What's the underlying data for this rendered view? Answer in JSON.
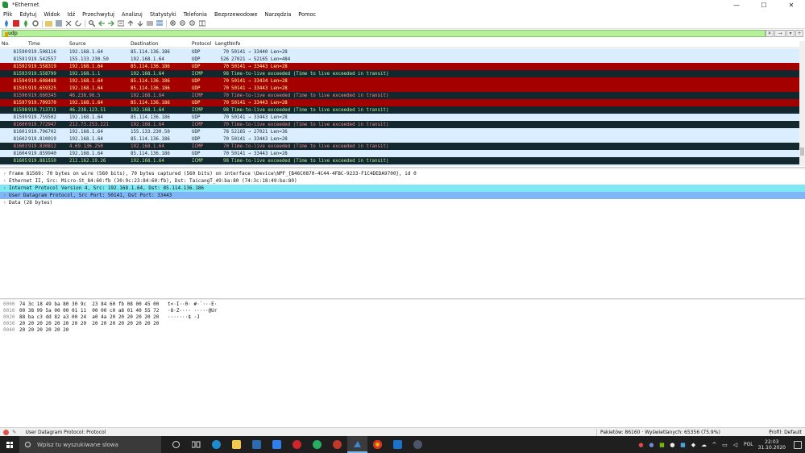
{
  "window": {
    "title": "*Ethernet",
    "min": "—",
    "max": "☐",
    "close": "✕"
  },
  "menu": [
    "Plik",
    "Edytuj",
    "Widok",
    "Idź",
    "Przechwytuj",
    "Analizuj",
    "Statystyki",
    "Telefonia",
    "Bezprzewodowe",
    "Narzędzia",
    "Pomoc"
  ],
  "filter": {
    "value": "udp"
  },
  "columns": {
    "no": "No.",
    "time": "Time",
    "source": "Source",
    "destination": "Destination",
    "protocol": "Protocol",
    "length": "Length",
    "info": "Info"
  },
  "packets": [
    {
      "no": "81590",
      "time": "919.508116",
      "src": "192.168.1.64",
      "dst": "85.114.136.186",
      "proto": "UDP",
      "len": "70",
      "info": "50141 → 33440 Len=28",
      "style": "udp"
    },
    {
      "no": "81591",
      "time": "919.542557",
      "src": "155.133.230.50",
      "dst": "192.168.1.64",
      "proto": "UDP",
      "len": "526",
      "info": "27021 → 52165 Len=484",
      "style": "udp"
    },
    {
      "no": "81592",
      "time": "919.558319",
      "src": "192.168.1.64",
      "dst": "85.114.136.186",
      "proto": "UDP",
      "len": "70",
      "info": "50141 → 33443 Len=28",
      "style": "udp-mark"
    },
    {
      "no": "81593",
      "time": "919.558799",
      "src": "192.168.1.1",
      "dst": "192.168.1.64",
      "proto": "ICMP",
      "len": "98",
      "info": "Time-to-live exceeded (Time to live exceeded in transit)",
      "style": "icmp-alt"
    },
    {
      "no": "81594",
      "time": "919.608488",
      "src": "192.168.1.64",
      "dst": "85.114.136.186",
      "proto": "UDP",
      "len": "70",
      "info": "50141 → 33434 Len=28",
      "style": "udp-mark"
    },
    {
      "no": "81595",
      "time": "919.659325",
      "src": "192.168.1.64",
      "dst": "85.114.136.186",
      "proto": "UDP",
      "len": "70",
      "info": "50141 → 33443 Len=28",
      "style": "udp-mark"
    },
    {
      "no": "81596",
      "time": "919.660345",
      "src": "46.238.96.5",
      "dst": "192.168.1.64",
      "proto": "ICMP",
      "len": "70",
      "info": "Time-to-live exceeded (Time to live exceeded in transit)",
      "style": "icmp"
    },
    {
      "no": "81597",
      "time": "919.709370",
      "src": "192.168.1.64",
      "dst": "85.114.136.186",
      "proto": "UDP",
      "len": "70",
      "info": "50141 → 33443 Len=28",
      "style": "udp-mark"
    },
    {
      "no": "81598",
      "time": "919.713731",
      "src": "46.238.123.51",
      "dst": "192.168.1.64",
      "proto": "ICMP",
      "len": "98",
      "info": "Time-to-live exceeded (Time to live exceeded in transit)",
      "style": "icmp-alt"
    },
    {
      "no": "81599",
      "time": "919.759502",
      "src": "192.168.1.64",
      "dst": "85.114.136.186",
      "proto": "UDP",
      "len": "70",
      "info": "50141 → 33443 Len=28",
      "style": "udp"
    },
    {
      "no": "81600",
      "time": "919.772947",
      "src": "212.73.253.221",
      "dst": "192.168.1.64",
      "proto": "ICMP",
      "len": "70",
      "info": "Time-to-live exceeded (Time to live exceeded in transit)",
      "style": "icmp"
    },
    {
      "no": "81601",
      "time": "919.796702",
      "src": "192.168.1.64",
      "dst": "155.133.230.50",
      "proto": "UDP",
      "len": "78",
      "info": "52165 → 27021 Len=36",
      "style": "udp"
    },
    {
      "no": "81602",
      "time": "919.810019",
      "src": "192.168.1.64",
      "dst": "85.114.136.186",
      "proto": "UDP",
      "len": "70",
      "info": "50141 → 33443 Len=28",
      "style": "udp"
    },
    {
      "no": "81603",
      "time": "919.830812",
      "src": "4.69.136.250",
      "dst": "192.168.1.64",
      "proto": "ICMP",
      "len": "70",
      "info": "Time-to-live exceeded (Time to live exceeded in transit)",
      "style": "icmp"
    },
    {
      "no": "81604",
      "time": "919.859940",
      "src": "192.168.1.64",
      "dst": "85.114.136.186",
      "proto": "UDP",
      "len": "70",
      "info": "50141 → 33443 Len=28",
      "style": "udp"
    },
    {
      "no": "81605",
      "time": "919.881550",
      "src": "212.162.19.26",
      "dst": "192.168.1.64",
      "proto": "ICMP",
      "len": "98",
      "info": "Time-to-live exceeded (Time to live exceeded in transit)",
      "style": "icmp-alt"
    },
    {
      "no": "81606",
      "time": "919.910262",
      "src": "192.168.1.64",
      "dst": "85.114.136.186",
      "proto": "UDP",
      "len": "70",
      "info": "50141 → 33443 Len=28",
      "style": "udp"
    }
  ],
  "details": [
    {
      "text": "Frame 81569: 70 bytes on wire (560 bits), 70 bytes captured (560 bits) on interface \\Device\\NPF_{B46C0870-4C44-4FBC-9233-F1C4DEDA9700}, id 0",
      "hl": ""
    },
    {
      "text": "Ethernet II, Src: Micro-St_84:60:fb (30:9c:23:84:60:fb), Dst: TaicangT_49:ba:80 (74:3c:18:49:ba:80)",
      "hl": ""
    },
    {
      "text": "Internet Protocol Version 4, Src: 192.168.1.64, Dst: 85.114.136.186",
      "hl": "hl-cyan"
    },
    {
      "text": "User Datagram Protocol, Src Port: 50141, Dst Port: 33443",
      "hl": "hl-blue"
    },
    {
      "text": "Data (28 bytes)",
      "hl": ""
    }
  ],
  "hex": [
    {
      "off": "0000",
      "bytes": "74 3c 18 49 ba 80 30 9c  23 84 60 fb 08 00 45 00",
      "ascii": "t<·I··0· #·`···E·"
    },
    {
      "off": "0010",
      "bytes": "00 38 99 5a 00 00 01 11  00 00 c0 a8 01 40 55 72",
      "ascii": "·8·Z···· ·····@Ur"
    },
    {
      "off": "0020",
      "bytes": "88 ba c3 dd 82 a3 00 24  a0 4a 20 20 20 20 20 20",
      "ascii": "·······$ ·J"
    },
    {
      "off": "0030",
      "bytes": "20 20 20 20 20 20 20 20  20 20 20 20 20 20 20 20",
      "ascii": ""
    },
    {
      "off": "0040",
      "bytes": "20 20 20 20 20 20",
      "ascii": ""
    }
  ],
  "status": {
    "text": "User Datagram Protocol: Protocol",
    "packets": "Pakietów: 86160 · Wyświetlanych: 65356 (75.9%)",
    "profile": "Profil: Default"
  },
  "taskbar": {
    "search_placeholder": "Wpisz tu wyszukiwane słowa",
    "lang": "POL",
    "time": "22:03",
    "date": "31.10.2020"
  },
  "colors": {
    "udp_bg": "#daeeff",
    "udp_mark_bg": "#a40000",
    "icmp_bg": "#12272e",
    "filter_ok": "#b5f09a",
    "detail_ip": "#7fe8f5",
    "detail_udp": "#80b6f5"
  }
}
